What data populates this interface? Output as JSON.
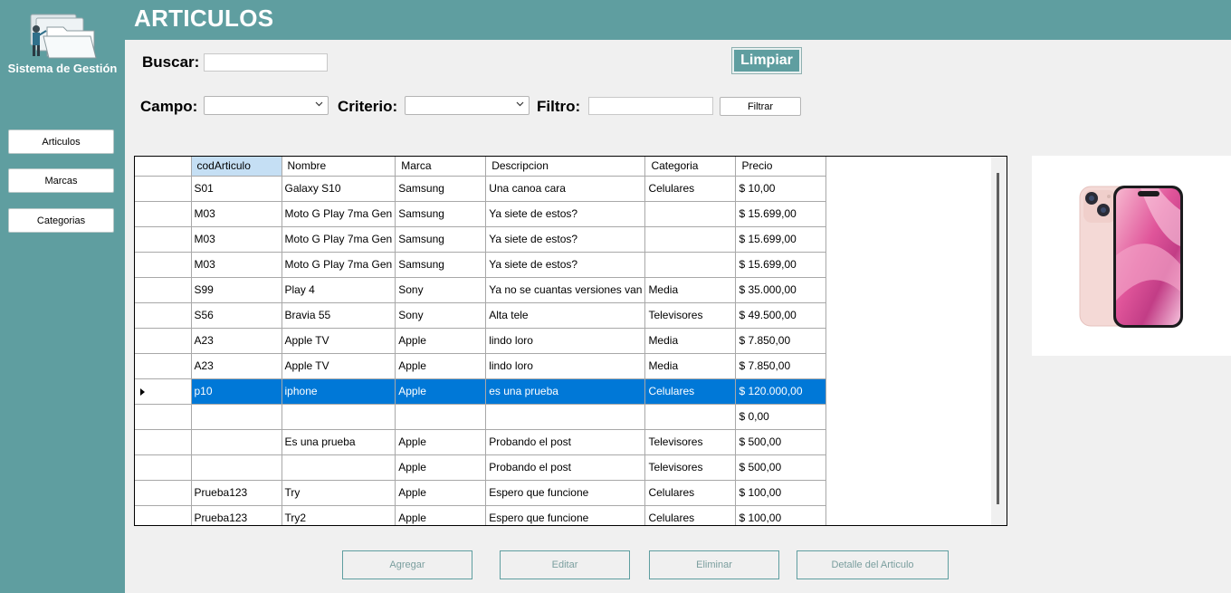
{
  "app": {
    "brand": "Sistema de Gestión",
    "page_title": "ARTICULOS"
  },
  "sidebar": {
    "items": [
      {
        "label": "Articulos"
      },
      {
        "label": "Marcas"
      },
      {
        "label": "Categorias"
      }
    ]
  },
  "search": {
    "label": "Buscar:",
    "value": "",
    "clear_label": "Limpiar"
  },
  "filter": {
    "campo_label": "Campo:",
    "campo_value": "",
    "criterio_label": "Criterio:",
    "criterio_value": "",
    "filtro_label": "Filtro:",
    "filtro_value": "",
    "button_label": "Filtrar"
  },
  "grid": {
    "columns": [
      "codArticulo",
      "Nombre",
      "Marca",
      "Descripcion",
      "Categoria",
      "Precio"
    ],
    "selected_row_index": 8,
    "rows": [
      [
        "S01",
        "Galaxy S10",
        "Samsung",
        "Una canoa cara",
        "Celulares",
        "$ 10,00"
      ],
      [
        "M03",
        "Moto G Play 7ma Gen",
        "Samsung",
        "Ya siete de estos?",
        "",
        "$ 15.699,00"
      ],
      [
        "M03",
        "Moto G Play 7ma Gen",
        "Samsung",
        "Ya siete de estos?",
        "",
        "$ 15.699,00"
      ],
      [
        "M03",
        "Moto G Play 7ma Gen",
        "Samsung",
        "Ya siete de estos?",
        "",
        "$ 15.699,00"
      ],
      [
        "S99",
        "Play 4",
        "Sony",
        "Ya no se cuantas versiones van",
        "Media",
        "$ 35.000,00"
      ],
      [
        "S56",
        "Bravia 55",
        "Sony",
        "Alta tele",
        "Televisores",
        "$ 49.500,00"
      ],
      [
        "A23",
        "Apple TV",
        "Apple",
        "lindo loro",
        "Media",
        "$ 7.850,00"
      ],
      [
        "A23",
        "Apple TV",
        "Apple",
        "lindo loro",
        "Media",
        "$ 7.850,00"
      ],
      [
        "p10",
        "iphone",
        "Apple",
        "es una prueba",
        "Celulares",
        "$ 120.000,00"
      ],
      [
        "",
        "",
        "",
        "",
        "",
        "$ 0,00"
      ],
      [
        "",
        "Es una prueba",
        "Apple",
        "Probando el post",
        "Televisores",
        "$ 500,00"
      ],
      [
        "",
        "",
        "Apple",
        "Probando el post",
        "Televisores",
        "$ 500,00"
      ],
      [
        "Prueba123",
        "Try",
        "Apple",
        "Espero que funcione",
        "Celulares",
        "$ 100,00"
      ],
      [
        "Prueba123",
        "Try2",
        "Apple",
        "Espero que funcione",
        "Celulares",
        "$ 100,00"
      ]
    ]
  },
  "image_preview": {
    "alt": "iphone"
  },
  "actions": {
    "add_label": "Agregar",
    "edit_label": "Editar",
    "delete_label": "Eliminar",
    "detail_label": "Detalle del Articulo"
  },
  "colors": {
    "accent": "#5f9ea0",
    "selection": "#0078d7",
    "background": "#f0f0f0"
  }
}
